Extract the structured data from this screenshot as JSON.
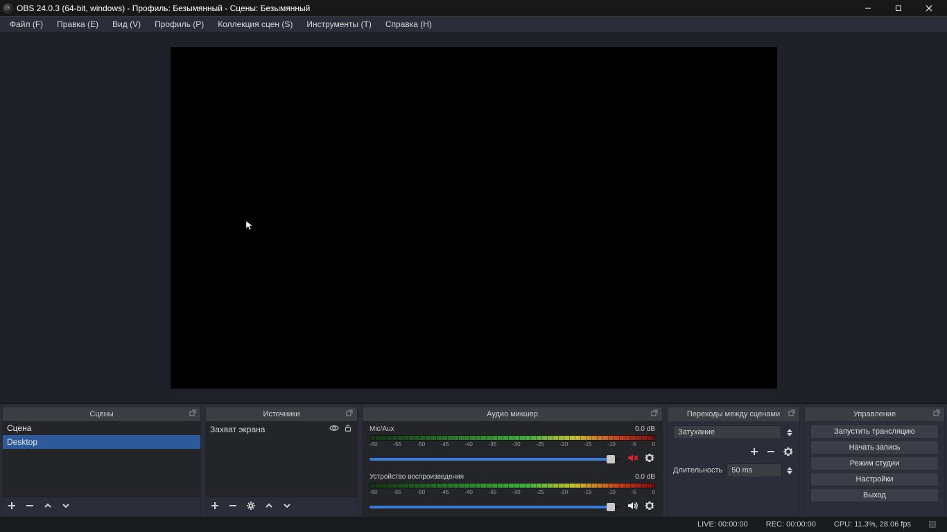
{
  "window": {
    "title": "OBS 24.0.3 (64-bit, windows) - Профиль: Безымянный - Сцены: Безымянный"
  },
  "menu": {
    "file": "Файл (F)",
    "edit": "Правка (E)",
    "view": "Вид (V)",
    "profile": "Профиль (P)",
    "scene_collection": "Коллекция сцен (S)",
    "tools": "Инструменты (T)",
    "help": "Справка (H)"
  },
  "panels": {
    "scenes": "Сцены",
    "sources": "Источники",
    "mixer": "Аудио микшер",
    "transitions": "Переходы между сценами",
    "controls": "Управление"
  },
  "scenes": {
    "items": [
      "Сцена",
      "Desktop"
    ],
    "selected": 1
  },
  "sources": {
    "items": [
      {
        "name": "Захват экрана"
      }
    ]
  },
  "mixer": {
    "scale": [
      "-60",
      "-55",
      "-50",
      "-45",
      "-40",
      "-35",
      "-30",
      "-25",
      "-20",
      "-15",
      "-10",
      "-5",
      "0"
    ],
    "tracks": [
      {
        "name": "Mic/Aux",
        "db": "0.0 dB",
        "muted": true,
        "fill_pct": 96
      },
      {
        "name": "Устройство воспроизведения",
        "db": "0.0 dB",
        "muted": false,
        "fill_pct": 96
      }
    ]
  },
  "transitions": {
    "current": "Затухание",
    "duration_label": "Длительность",
    "duration": "50 ms"
  },
  "controls": {
    "start_stream": "Запустить трансляцию",
    "start_record": "Начать запись",
    "studio_mode": "Режим студии",
    "settings": "Настройки",
    "exit": "Выход"
  },
  "status": {
    "live": "LIVE: 00:00:00",
    "rec": "REC: 00:00:00",
    "cpu": "CPU: 11.3%, 28.06 fps"
  }
}
